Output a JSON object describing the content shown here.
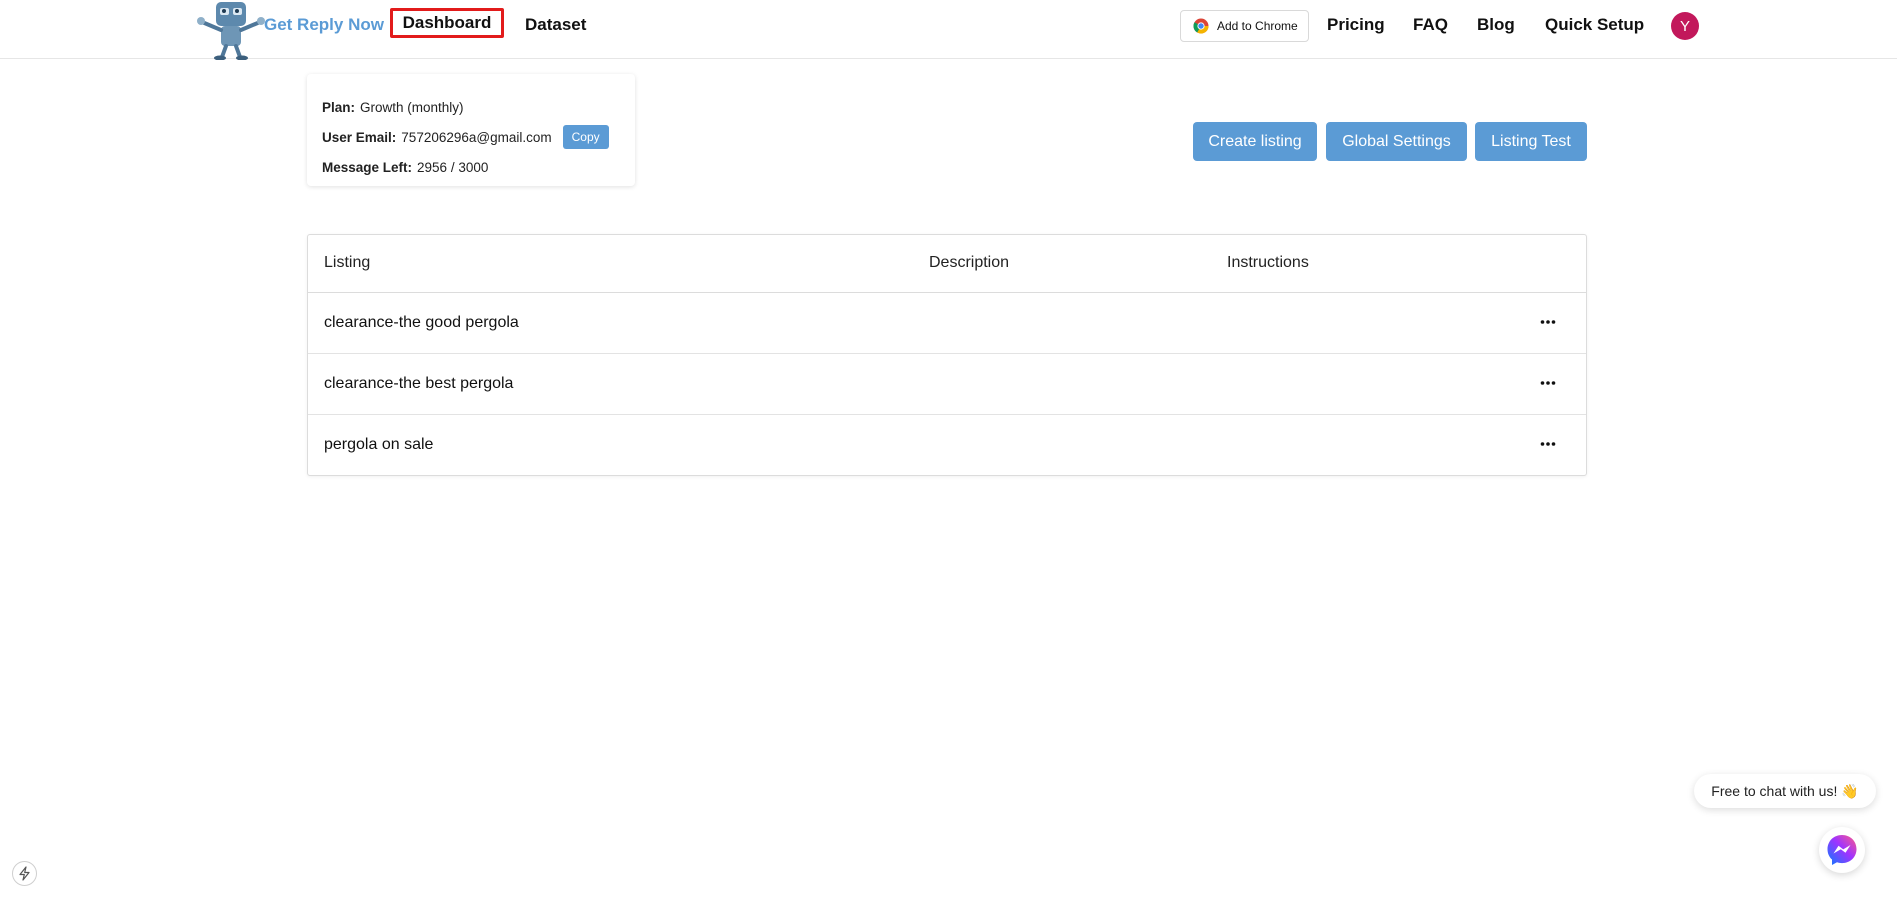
{
  "header": {
    "brand": "Get Reply Now",
    "nav": {
      "dashboard": "Dashboard",
      "dataset": "Dataset",
      "add_to_chrome": "Add to Chrome",
      "pricing": "Pricing",
      "faq": "FAQ",
      "blog": "Blog",
      "quick_setup": "Quick Setup"
    },
    "avatar_initial": "Y",
    "icons": [
      "robot-mascot-logo",
      "chrome-icon"
    ]
  },
  "account": {
    "plan_label": "Plan:",
    "plan_value": "Growth (monthly)",
    "email_label": "User Email:",
    "email_value": "757206296a@gmail.com",
    "copy_label": "Copy",
    "messages_label": "Message Left:",
    "messages_value": "2956 / 3000"
  },
  "actions": {
    "create_listing": "Create listing",
    "global_settings": "Global Settings",
    "listing_test": "Listing Test"
  },
  "table": {
    "columns": [
      "Listing",
      "Description",
      "Instructions"
    ],
    "rows": [
      {
        "listing": "clearance-the good pergola",
        "description": "",
        "instructions": ""
      },
      {
        "listing": "clearance-the best pergola",
        "description": "",
        "instructions": ""
      },
      {
        "listing": "pergola on sale",
        "description": "",
        "instructions": ""
      }
    ]
  },
  "chat": {
    "prompt": "Free to chat with us! 👋",
    "icon": "messenger-icon"
  },
  "colors": {
    "accent": "#5b9bd5",
    "highlight": "#e21b1b",
    "avatar": "#c2185b"
  }
}
